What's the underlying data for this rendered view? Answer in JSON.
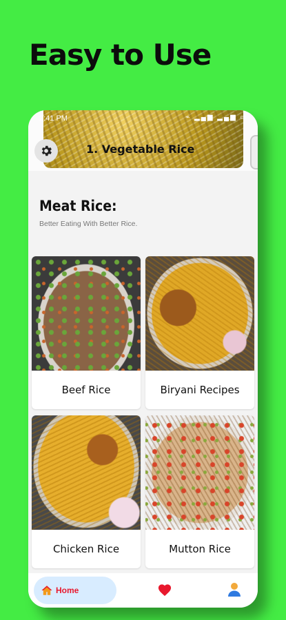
{
  "promo": {
    "headline": "Easy to Use"
  },
  "status_bar": {
    "time": "2:41 PM",
    "icons": "⌁ ▂▄▆ ▂▄▆ ▭"
  },
  "banner": {
    "title": "1. Vegetable Rice"
  },
  "section": {
    "title": "Meat Rice:",
    "subtitle": "Better Eating With Better Rice."
  },
  "recipes": [
    {
      "label": "Beef Rice"
    },
    {
      "label": "Biryani Recipes"
    },
    {
      "label": "Chicken Rice"
    },
    {
      "label": "Mutton Rice"
    }
  ],
  "nav": {
    "home_label": "Home"
  },
  "colors": {
    "background": "#44ec44",
    "home_pill": "#d8ecff",
    "home_accent": "#e8182d",
    "heart": "#e8182d",
    "profile": "#2f7ae0"
  },
  "icons": {
    "settings": "gear-icon",
    "home": "home-icon",
    "favorites": "heart-icon",
    "profile": "profile-icon"
  }
}
